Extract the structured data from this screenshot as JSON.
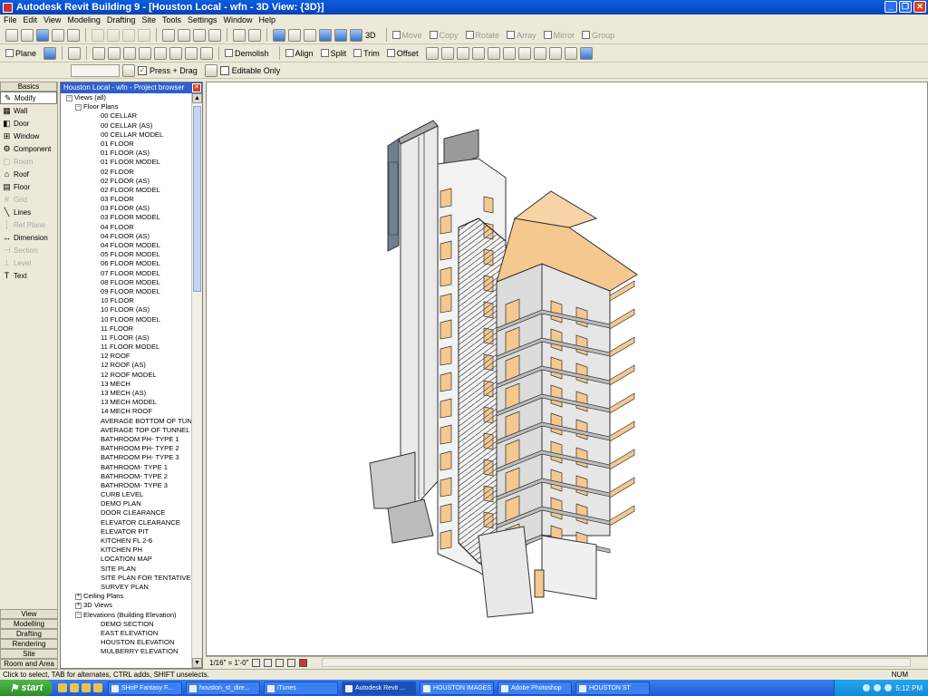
{
  "window": {
    "title": "Autodesk Revit Building 9 - [Houston Local - wfn - 3D View: {3D}]"
  },
  "menu": [
    "File",
    "Edit",
    "View",
    "Modeling",
    "Drafting",
    "Site",
    "Tools",
    "Settings",
    "Window",
    "Help"
  ],
  "toolbar1": {
    "threed_label": "3D",
    "disabled_tools": [
      "Move",
      "Copy",
      "Rotate",
      "Array",
      "Mirror",
      "Group"
    ]
  },
  "toolbar2": {
    "plane_label": "Plane",
    "demolish_label": "Demolish",
    "align_label": "Align",
    "split_label": "Split",
    "trim_label": "Trim",
    "offset_label": "Offset"
  },
  "options_bar": {
    "press_drag": "Press + Drag",
    "editable_only": "Editable Only"
  },
  "design_bar": {
    "active_tab": "Basics",
    "items": [
      {
        "label": "Modify",
        "icon": "✎",
        "selected": true,
        "disabled": false
      },
      {
        "label": "Wall",
        "icon": "▦",
        "selected": false,
        "disabled": false
      },
      {
        "label": "Door",
        "icon": "◧",
        "selected": false,
        "disabled": false
      },
      {
        "label": "Window",
        "icon": "⊞",
        "selected": false,
        "disabled": false
      },
      {
        "label": "Component",
        "icon": "⚙",
        "selected": false,
        "disabled": false
      },
      {
        "label": "Room",
        "icon": "▢",
        "selected": false,
        "disabled": true
      },
      {
        "label": "Roof",
        "icon": "⌂",
        "selected": false,
        "disabled": false
      },
      {
        "label": "Floor",
        "icon": "▤",
        "selected": false,
        "disabled": false
      },
      {
        "label": "Grid",
        "icon": "#",
        "selected": false,
        "disabled": true
      },
      {
        "label": "Lines",
        "icon": "╲",
        "selected": false,
        "disabled": false
      },
      {
        "label": "Ref Plane",
        "icon": "┆",
        "selected": false,
        "disabled": true
      },
      {
        "label": "Dimension",
        "icon": "↔",
        "selected": false,
        "disabled": false
      },
      {
        "label": "Section",
        "icon": "⊣",
        "selected": false,
        "disabled": true
      },
      {
        "label": "Level",
        "icon": "⊥",
        "selected": false,
        "disabled": true
      },
      {
        "label": "Text",
        "icon": "T",
        "selected": false,
        "disabled": false
      }
    ],
    "bottom_tabs": [
      "View",
      "Modelling",
      "Drafting",
      "Rendering",
      "Site",
      "Room and Area"
    ]
  },
  "project_browser": {
    "title": "Houston Local - wfn - Project browser",
    "root": "Views (all)",
    "floor_plans_label": "Floor Plans",
    "floor_plans": [
      "00 CELLAR",
      "00 CELLAR (AS)",
      "00 CELLAR MODEL",
      "01 FLOOR",
      "01 FLOOR (AS)",
      "01 FLOOR MODEL",
      "02 FLOOR",
      "02 FLOOR (AS)",
      "02 FLOOR MODEL",
      "03 FLOOR",
      "03 FLOOR (AS)",
      "03 FLOOR MODEL",
      "04 FLOOR",
      "04 FLOOR (AS)",
      "04 FLOOR MODEL",
      "05 FLOOR MODEL",
      "06 FLOOR MODEL",
      "07 FLOOR MODEL",
      "08 FLOOR MODEL",
      "09 FLOOR MODEL",
      "10 FLOOR",
      "10 FLOOR (AS)",
      "10 FLOOR MODEL",
      "11 FLOOR",
      "11 FLOOR (AS)",
      "11 FLOOR MODEL",
      "12 ROOF",
      "12 ROOF (AS)",
      "12 ROOF MODEL",
      "13 MECH",
      "13 MECH (AS)",
      "13 MECH MODEL",
      "14 MECH ROOF",
      "AVERAGE BOTTOM OF TUNN",
      "AVERAGE TOP OF TUNNEL",
      "BATHROOM PH- TYPE 1",
      "BATHROOM PH- TYPE 2",
      "BATHROOM PH- TYPE 3",
      "BATHROOM- TYPE 1",
      "BATHROOM- TYPE 2",
      "BATHROOM- TYPE 3",
      "CURB LEVEL",
      "DEMO PLAN",
      "DOOR CLEARANCE",
      "ELEVATOR CLEARANCE",
      "ELEVATOR PIT",
      "KITCHEN FL 2-6",
      "KITCHEN PH",
      "LOCATION MAP",
      "SITE PLAN",
      "SITE PLAN FOR TENTATIVE L",
      "SURVEY PLAN"
    ],
    "ceiling_plans_label": "Ceiling Plans",
    "views3d_label": "3D Views",
    "elevations_label": "Elevations (Building Elevation)",
    "elevations": [
      "DEMO SECTION",
      "EAST ELEVATION",
      "HOUSTON ELEVATION",
      "MULBERRY ELEVATION"
    ]
  },
  "view_control": {
    "scale": "1/16\" = 1'-0\""
  },
  "status": {
    "message": "Click to select, TAB for alternates, CTRL adds, SHIFT unselects.",
    "num": "NUM"
  },
  "taskbar": {
    "start_label": "start",
    "tasks": [
      "SHoP Fantasy F...",
      "houston_st_dire...",
      "iTunes",
      "Autodesk Revit ...",
      "HOUSTON IMAGES",
      "Adobe Photoshop",
      "HOUSTON ST"
    ],
    "active_task": 3,
    "clock": "5:12 PM"
  },
  "colors": {
    "accent": "#2f5fcf",
    "floor_slab": "#f5c890",
    "wall": "#d8d8d8"
  }
}
